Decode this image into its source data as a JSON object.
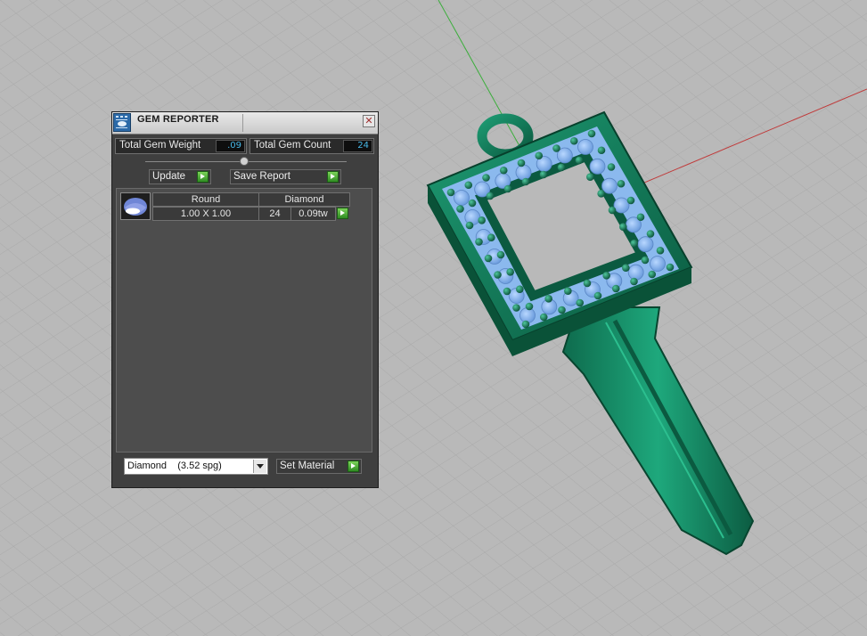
{
  "window": {
    "title": "GEM REPORTER",
    "close_glyph": "✕"
  },
  "stats": {
    "total_weight_label": "Total Gem Weight",
    "total_weight_value": ".09",
    "total_count_label": "Total Gem Count",
    "total_count_value": "24"
  },
  "buttons": {
    "update_label": "Update",
    "save_report_label": "Save Report",
    "set_material_label": "Set Material"
  },
  "gem_table": {
    "rows": [
      {
        "shape": "Round",
        "material": "Diamond",
        "size": "1.00 X 1.00",
        "count": "24",
        "weight": "0.09tw"
      }
    ]
  },
  "material_select": {
    "selected": "Diamond    (3.52 spg)"
  },
  "icons": {
    "app": "gem-reporter-app-icon",
    "close": "close-icon",
    "go": "green-arrow-icon",
    "thumb": "round-gem-icon",
    "dropdown": "chevron-down-icon"
  },
  "colors": {
    "viewport_bg": "#b9b9b9",
    "model_metal": "#137a5a",
    "gem_fill": "#7fb0e8",
    "panel_bg": "#3f3f3f",
    "value_text": "#47b7e6",
    "accent_green": "#3aa52a"
  }
}
